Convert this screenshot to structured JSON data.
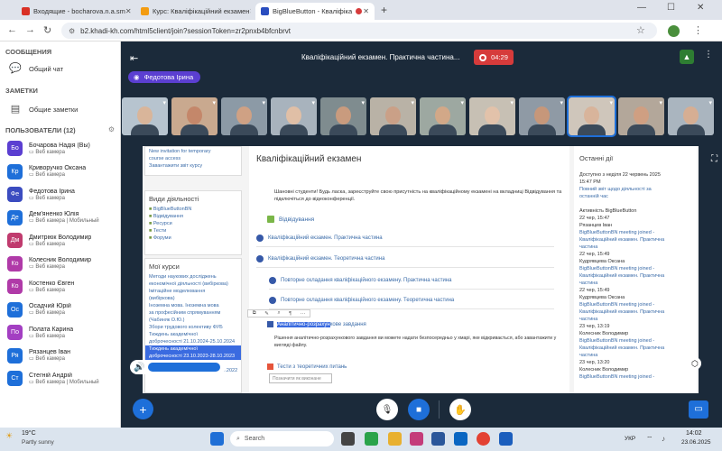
{
  "browser": {
    "tabs": [
      {
        "title": "Входящие - bocharova.n.a.sm"
      },
      {
        "title": "Курс: Кваліфікаційний екзамен"
      },
      {
        "title": "BigBlueButton - Кваліфіка"
      }
    ],
    "url": "b2.khadi-kh.com/html5client/join?sessionToken=zr2pnxb4bfcnbrvt"
  },
  "sidebar": {
    "messages_title": "СООБЩЕНИЯ",
    "public_chat": "Общий чат",
    "notes_title": "ЗАМЕТКИ",
    "shared_notes": "Общие заметки",
    "users_title": "ПОЛЬЗОВАТЕЛИ (12)",
    "users": [
      {
        "initials": "Бо",
        "name": "Бочарова Надія (Вы)",
        "sub": "Веб камера",
        "color": "#5b3fd1"
      },
      {
        "initials": "Кр",
        "name": "Криворучко Оксана",
        "sub": "Веб камера",
        "color": "#1e6fd9"
      },
      {
        "initials": "Фе",
        "name": "Федотова Ірина",
        "sub": "Веб камера",
        "color": "#3b4cc0"
      },
      {
        "initials": "Де",
        "name": "Дем'яненко Юлія",
        "sub": "Веб камера | Мобильный",
        "color": "#1e6fd9"
      },
      {
        "initials": "Дм",
        "name": "Дмитріюк Володимир",
        "sub": "Веб камера",
        "color": "#c03b6e"
      },
      {
        "initials": "Ко",
        "name": "Колесник Володимир",
        "sub": "Веб камера",
        "color": "#b03aa8"
      },
      {
        "initials": "Ко",
        "name": "Костенко Євген",
        "sub": "Веб камера",
        "color": "#b03aa8"
      },
      {
        "initials": "Ос",
        "name": "Осадчий Юрій",
        "sub": "Веб камера",
        "color": "#1e6fd9"
      },
      {
        "initials": "По",
        "name": "Полата Карина",
        "sub": "Веб камера",
        "color": "#a33fc2"
      },
      {
        "initials": "Ря",
        "name": "Рязанцев Іван",
        "sub": "Веб камера",
        "color": "#1e6fd9"
      },
      {
        "initials": "Ст",
        "name": "Стегній Андрій",
        "sub": "Веб камера | Мобильный",
        "color": "#1e6fd9"
      }
    ]
  },
  "meeting": {
    "title": "Кваліфікаційний екзамен. Практична частина...",
    "timer": "04:29",
    "presenter": "Федотова Ірина"
  },
  "share": {
    "left": {
      "top_links": [
        "New invitation for temporary",
        "course access",
        "Завантажити звіт курсу"
      ],
      "activities_title": "Види діяльності",
      "activities": [
        "BigBlueButtonBN",
        "Відвідування",
        "Ресурси",
        "Тести",
        "Форуми"
      ],
      "courses_title": "Мої курси",
      "courses": [
        "Методи наукових досліджень",
        "економічної діяльності (вибіркова)",
        "Імітаційне моделювання",
        "(вибіркова)",
        "Іноземна мова. Іноземна мова",
        "за професійним спрямуванням",
        "(Чабиняк О.Ю.)",
        "Збори трудового колективу ФУБ",
        "Тиждень академічної",
        "доброчесності 21.10.2024-25.10.2024",
        "Тиждень академічної",
        "доброчесності 23.10.2023-28.10.2023",
        "Тиждень академічної",
        "доброчесності 17.10.2022 - 21.10.2022"
      ]
    },
    "center": {
      "heading": "Кваліфікаційний екзамен",
      "intro1": "Шановні студенти! Будь ласка, зареєструйте свою присутність на кваліфікаційному екзамені на вкладниці Відвідування та",
      "intro2": "підключіться до відеоконференції.",
      "attendance": "Відвідування",
      "activities": [
        "Кваліфікаційний екзамен. Практична частина",
        "Кваліфікаційний екзамен. Теоретична частина",
        "Повторне складання кваліфікаційного екзамену. Практична частина",
        "Повторне складання кваліфікаційного екзамену. Теоретична частина"
      ],
      "task_highlight": "Аналітично-розрахун",
      "task_rest": "кове завдання",
      "task_text1": "Рішення аналітично-розрахункового завдання ви можете надати безпосередньо у хмарі, яке відкривається, або завантажити у",
      "task_text2": "вигляді файлу.",
      "test_title": "Тести з теоретичних питань",
      "test_placeholder": "Позначити як виконане"
    },
    "right": {
      "heading": "Останні дії",
      "since1": "Доступно з неділя 22 червень 2025",
      "since2": "15:47 PM",
      "since_link1": "Повний звіт щодо діяльності за",
      "since_link2": "останній час",
      "bbb_title": "Активність BigBlueButton",
      "entries": [
        {
          "date": "22 чер, 15:47",
          "name": "Рязанцев Іван",
          "link1": "BigBlueButtonBN meeting joined -",
          "link2": "Кваліфікаційний екзамен. Практична",
          "link3": "частина"
        },
        {
          "date": "22 чер, 15:49",
          "name": "Кудрявцева Оксана",
          "link1": "BigBlueButtonBN meeting joined -",
          "link2": "Кваліфікаційний екзамен. Практична",
          "link3": "частина"
        },
        {
          "date": "22 чер, 15:49",
          "name": "Кудрявцева Оксана",
          "link1": "BigBlueButtonBN meeting joined -",
          "link2": "Кваліфікаційний екзамен. Практична",
          "link3": "частина"
        },
        {
          "date": "23 чер, 13:19",
          "name": "Колесник Володимир",
          "link1": "BigBlueButtonBN meeting joined -",
          "link2": "Кваліфікаційний екзамен. Практична",
          "link3": "частина"
        },
        {
          "date": "23 чер, 13:20",
          "name": "Колесник Володимир",
          "link1": "BigBlueButtonBN meeting joined -",
          "link2": "",
          "link3": ""
        }
      ]
    }
  },
  "taskbar": {
    "weather_temp": "19°C",
    "weather_text": "Partly sunny",
    "search_placeholder": "Search",
    "lang": "УКР",
    "time": "14:02",
    "date": "23.06.2025"
  },
  "colors": {
    "accent": "#5b3fd1",
    "record": "#d63b3b",
    "control_blue": "#1e6fd9",
    "meeting_bg": "#1b2a3a"
  }
}
